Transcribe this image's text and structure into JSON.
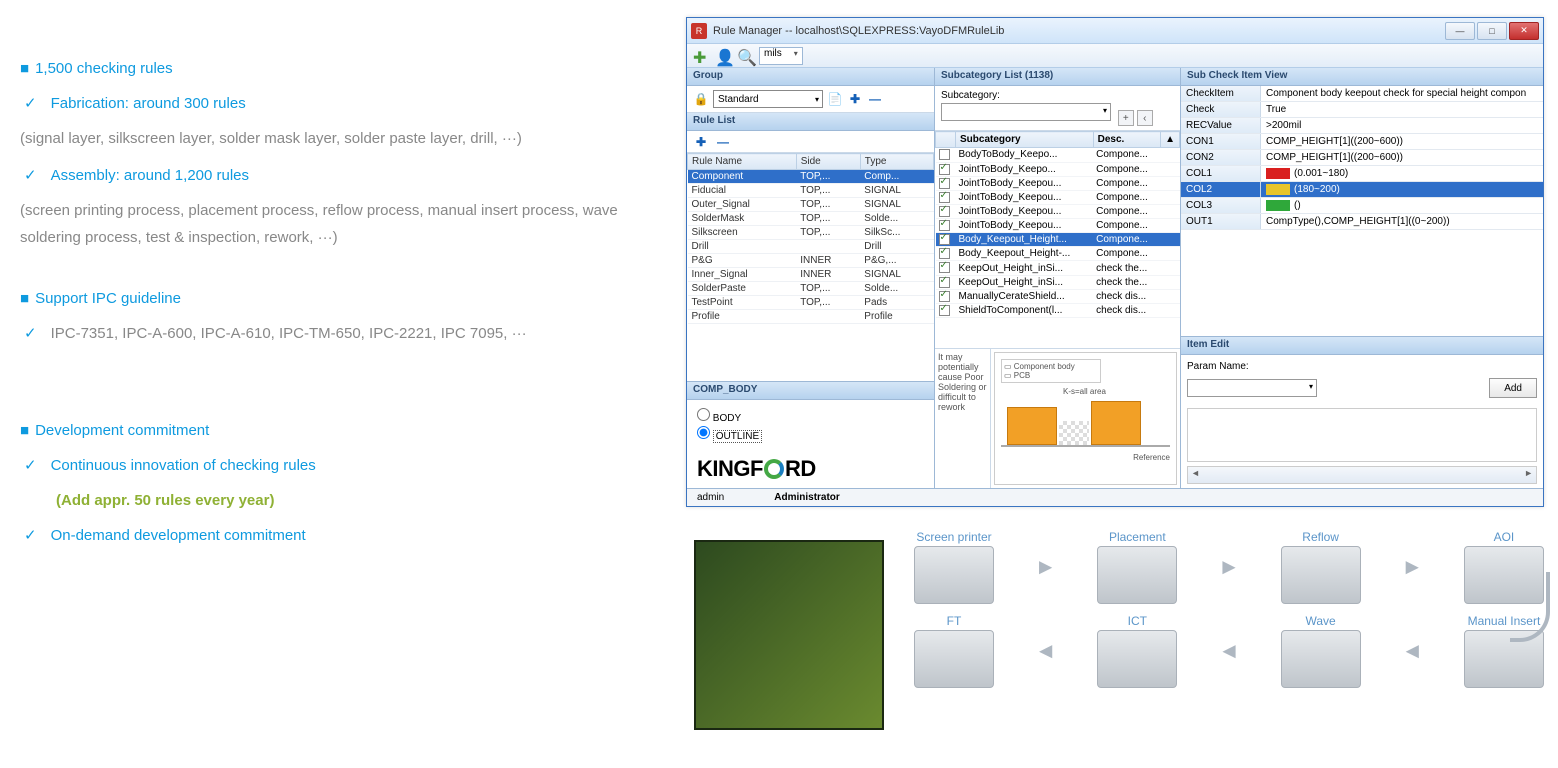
{
  "left": {
    "h1": "1,500 checking rules",
    "fab": "Fabrication: around 300 rules",
    "fab_sub": "(signal layer, silkscreen layer, solder mask layer, solder paste layer, drill, ···)",
    "asm": "Assembly: around 1,200 rules",
    "asm_sub": "(screen printing process, placement process, reflow process, manual insert process, wave soldering process, test & inspection, rework, ···)",
    "h2": "Support IPC guideline",
    "ipc": "IPC-7351, IPC-A-600, IPC-A-610, IPC-TM-650, IPC-2221, IPC 7095, ···",
    "h3": "Development commitment",
    "dev1": "Continuous innovation of checking rules",
    "dev1b": "(Add appr. 50 rules every year)",
    "dev2": "On-demand development commitment"
  },
  "window": {
    "title": "Rule Manager  --  localhost\\SQLEXPRESS:VayoDFMRuleLib",
    "unit": "mils",
    "group_hdr": "Group",
    "group_sel": "Standard",
    "rulelist_hdr": "Rule List",
    "rule_cols": [
      "Rule Name",
      "Side",
      "Type"
    ],
    "rules": [
      {
        "n": "Component",
        "s": "TOP,...",
        "t": "Comp...",
        "sel": true
      },
      {
        "n": "Fiducial",
        "s": "TOP,...",
        "t": "SIGNAL"
      },
      {
        "n": "Outer_Signal",
        "s": "TOP,...",
        "t": "SIGNAL"
      },
      {
        "n": "SolderMask",
        "s": "TOP,...",
        "t": "Solde..."
      },
      {
        "n": "Silkscreen",
        "s": "TOP,...",
        "t": "SilkSc..."
      },
      {
        "n": "Drill",
        "s": "",
        "t": "Drill"
      },
      {
        "n": "P&G",
        "s": "INNER",
        "t": "P&G,..."
      },
      {
        "n": "Inner_Signal",
        "s": "INNER",
        "t": "SIGNAL"
      },
      {
        "n": "SolderPaste",
        "s": "TOP,...",
        "t": "Solde..."
      },
      {
        "n": "TestPoint",
        "s": "TOP,...",
        "t": "Pads"
      },
      {
        "n": "Profile",
        "s": "",
        "t": "Profile"
      }
    ],
    "compbody_hdr": "COMP_BODY",
    "radio1": "BODY",
    "radio2": "OUTLINE",
    "logo": "KINGF RD",
    "subcat_hdr": "Subcategory List (1138)",
    "subcat_lbl": "Subcategory:",
    "sub_cols": [
      "Subcategory",
      "Desc."
    ],
    "subs": [
      {
        "n": "BodyToBody_Keepo...",
        "d": "Compone...",
        "c": false
      },
      {
        "n": "JointToBody_Keepo...",
        "d": "Compone...",
        "c": true
      },
      {
        "n": "JointToBody_Keepou...",
        "d": "Compone...",
        "c": true
      },
      {
        "n": "JointToBody_Keepou...",
        "d": "Compone...",
        "c": true
      },
      {
        "n": "JointToBody_Keepou...",
        "d": "Compone...",
        "c": true
      },
      {
        "n": "JointToBody_Keepou...",
        "d": "Compone...",
        "c": true
      },
      {
        "n": "Body_Keepout_Height...",
        "d": "Compone...",
        "c": true,
        "sel": true
      },
      {
        "n": "Body_Keepout_Height-...",
        "d": "Compone...",
        "c": true
      },
      {
        "n": "KeepOut_Height_inSi...",
        "d": "check the...",
        "c": true
      },
      {
        "n": "KeepOut_Height_inSi...",
        "d": "check the...",
        "c": true
      },
      {
        "n": "ManuallyCerateShield...",
        "d": "check dis...",
        "c": true
      },
      {
        "n": "ShieldToComponent(l...",
        "d": "check dis...",
        "c": true
      }
    ],
    "potential": "It may potentially cause Poor Soldering or difficult to rework",
    "diag_leg1": "Component body",
    "diag_leg2": "PCB",
    "diag_ks": "K-s=all area",
    "diag_ref": "Reference",
    "check_hdr": "Sub Check Item View",
    "kv": [
      {
        "k": "CheckItem",
        "v": "Component body keepout check for special height compon"
      },
      {
        "k": "Check",
        "v": "True"
      },
      {
        "k": "RECValue",
        "v": ">200mil"
      },
      {
        "k": "CON1",
        "v": "COMP_HEIGHT[1]((200~600))"
      },
      {
        "k": "CON2",
        "v": "COMP_HEIGHT[1]((200~600))"
      },
      {
        "k": "COL1",
        "v": "(0.001~180)",
        "sw": "#d91f1f"
      },
      {
        "k": "COL2",
        "v": "(180~200)",
        "sw": "#e8c52a",
        "sel": true
      },
      {
        "k": "COL3",
        "v": "()",
        "sw": "#2fa83a"
      },
      {
        "k": "OUT1",
        "v": "CompType(),COMP_HEIGHT[1]((0~200))"
      }
    ],
    "itemedit_hdr": "Item Edit",
    "param_lbl": "Param Name:",
    "add_btn": "Add",
    "status_user": "admin",
    "status_role": "Administrator"
  },
  "flow": {
    "row1": [
      "Screen printer",
      "Placement",
      "Reflow",
      "AOI"
    ],
    "row2": [
      "FT",
      "ICT",
      "Wave",
      "Manual Insert"
    ]
  }
}
